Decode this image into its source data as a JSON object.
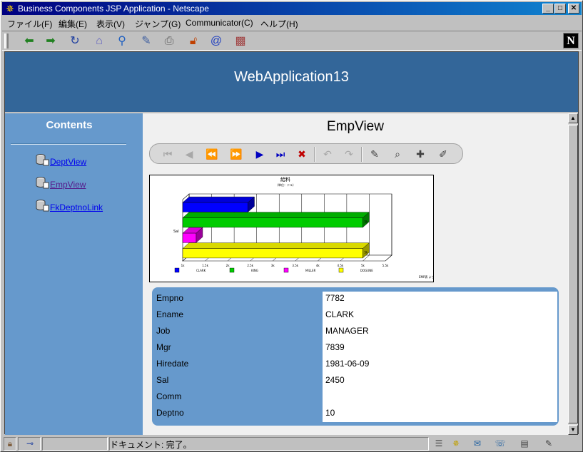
{
  "window": {
    "title": "Business Components JSP Application - Netscape",
    "controls": {
      "minimize": "_",
      "maximize": "□",
      "close": "✕"
    }
  },
  "menubar": {
    "items": [
      "ファイル(F)",
      "編集(E)",
      "表示(V)",
      "ジャンプ(G)",
      "Communicator(C)",
      "ヘルプ(H)"
    ]
  },
  "toolbar": {
    "icons": [
      "back-icon",
      "forward-icon",
      "reload-icon",
      "home-icon",
      "search-icon",
      "netscape-guide-icon",
      "print-icon",
      "security-icon",
      "shop-icon",
      "stop-icon"
    ],
    "logo": "N"
  },
  "page": {
    "app_title": "WebApplication13",
    "sidebar": {
      "title": "Contents",
      "links": [
        "DeptView",
        "EmpView",
        "FkDeptnoLink"
      ]
    },
    "view_title": "EmpView"
  },
  "chart_data": {
    "type": "bar",
    "orientation": "horizontal",
    "title": "給料",
    "subtitle": "(単位：ドル)",
    "ylabel": "Sal",
    "x_ticks": [
      "1k",
      "1.5k",
      "2k",
      "2.5k",
      "3k",
      "3.5k",
      "4k",
      "4.5k",
      "5k",
      "5.5k"
    ],
    "xlim": [
      1000,
      5500
    ],
    "series": [
      {
        "name": "CLARK",
        "values": [
          2450
        ],
        "color": "#0000ff"
      },
      {
        "name": "KING",
        "values": [
          5000
        ],
        "color": "#00cc00"
      },
      {
        "name": "MILLER",
        "values": [
          1300
        ],
        "color": "#ff00ff"
      },
      {
        "name": "DOGUNE",
        "values": [
          5000
        ],
        "color": "#ffff00"
      }
    ],
    "data_labels": [
      "5k",
      "",
      "5k"
    ],
    "legend_position": "bottom",
    "footnote": "EMP表 より"
  },
  "form": {
    "fields": [
      {
        "label": "Empno",
        "value": "7782"
      },
      {
        "label": "Ename",
        "value": "CLARK"
      },
      {
        "label": "Job",
        "value": "MANAGER"
      },
      {
        "label": "Mgr",
        "value": "7839"
      },
      {
        "label": "Hiredate",
        "value": "1981-06-09"
      },
      {
        "label": "Sal",
        "value": "2450"
      },
      {
        "label": "Comm",
        "value": ""
      },
      {
        "label": "Deptno",
        "value": "10"
      }
    ]
  },
  "statusbar": {
    "text": "ドキュメント: 完了。"
  }
}
